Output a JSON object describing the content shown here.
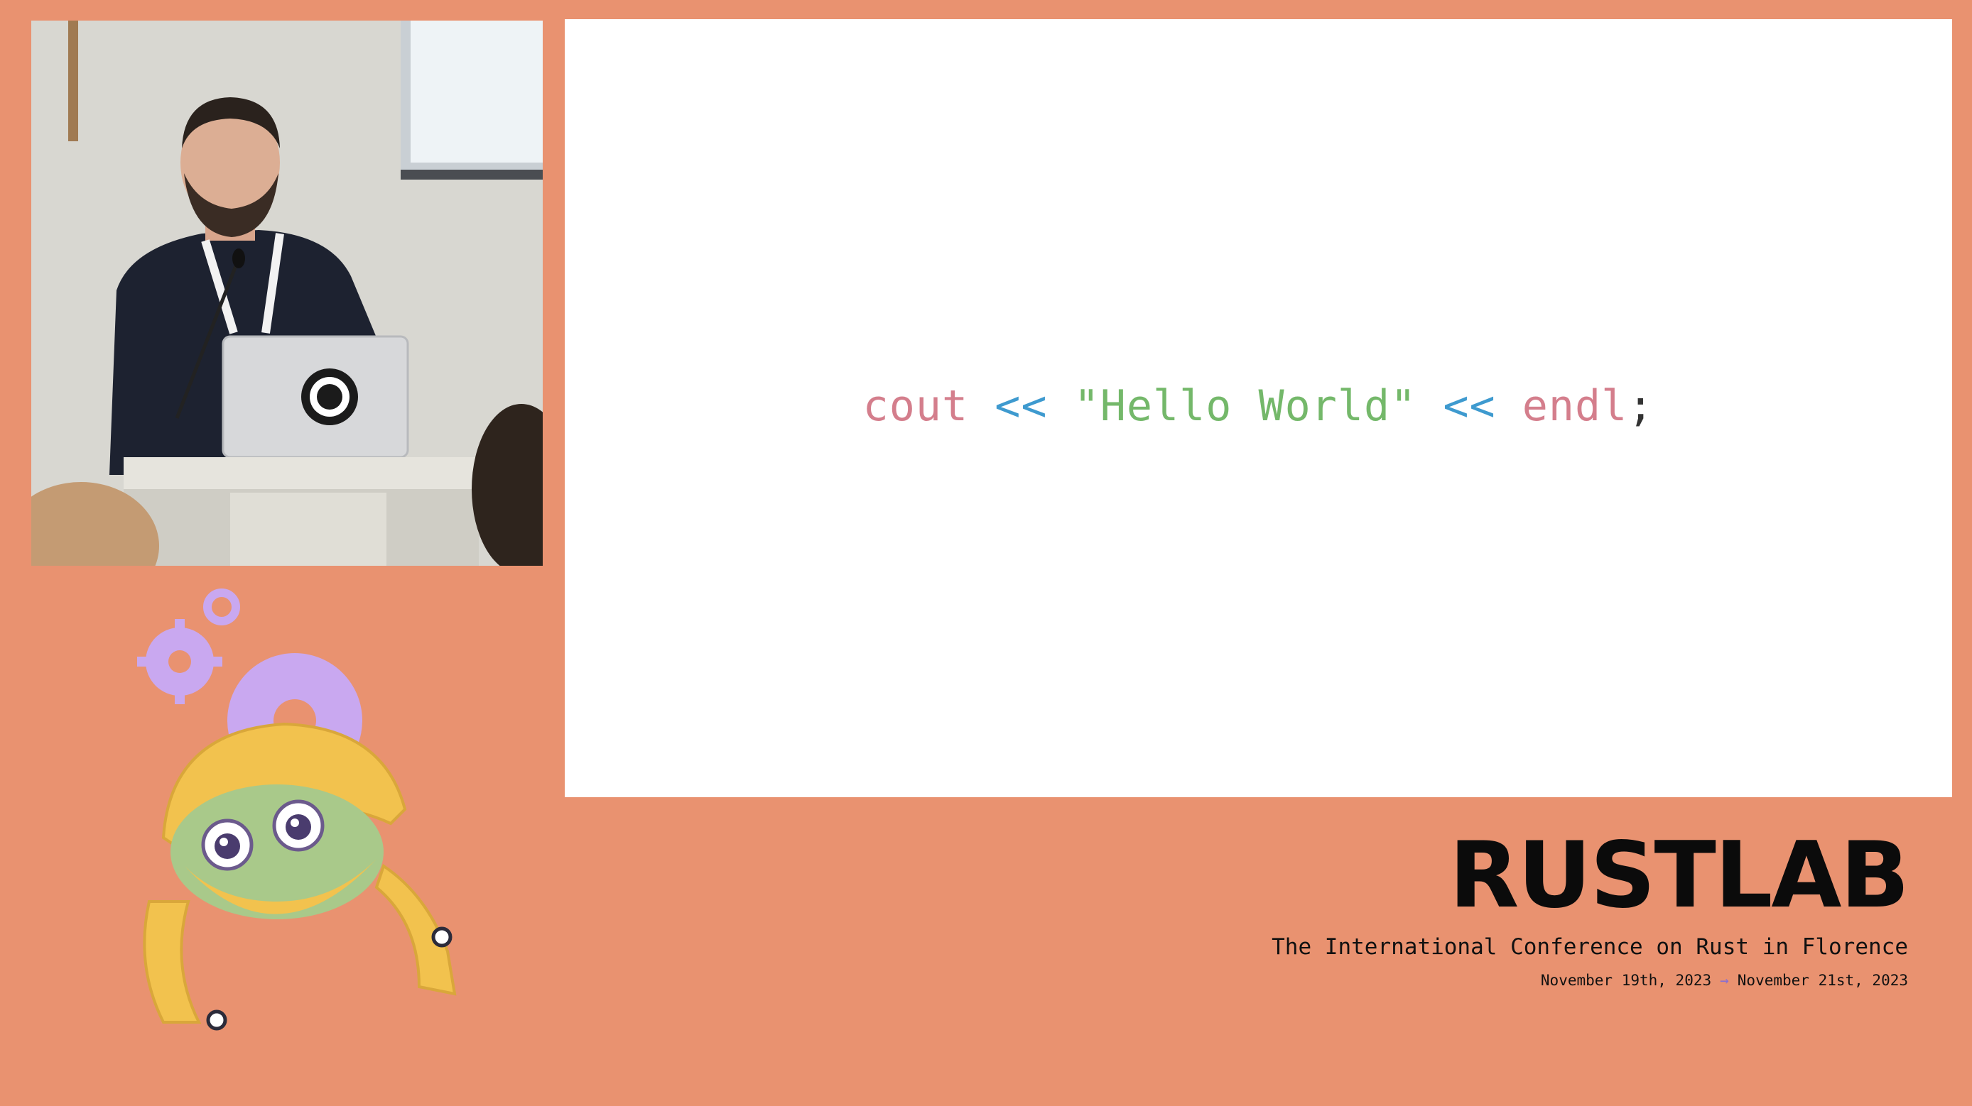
{
  "slide": {
    "code": {
      "tok1": "cout",
      "tok2": "<<",
      "tok3": "\"Hello World\"",
      "tok4": "<<",
      "tok5": "endl",
      "tok6": ";"
    }
  },
  "branding": {
    "title": "RUSTLAB",
    "subtitle": "The International Conference on Rust in Florence",
    "date_start": "November 19th, 2023",
    "date_arrow": "→",
    "date_end": "November 21st, 2023"
  },
  "colors": {
    "background": "#E99270",
    "code_identifier": "#D47E8C",
    "code_operator": "#3E9ACF",
    "code_string": "#74B86A",
    "gear_lavender": "#C9A8F0"
  },
  "icons": {
    "mascot": "gear-crab-mascot-icon",
    "laptop_logo": "rust-logo-sticker-icon"
  }
}
